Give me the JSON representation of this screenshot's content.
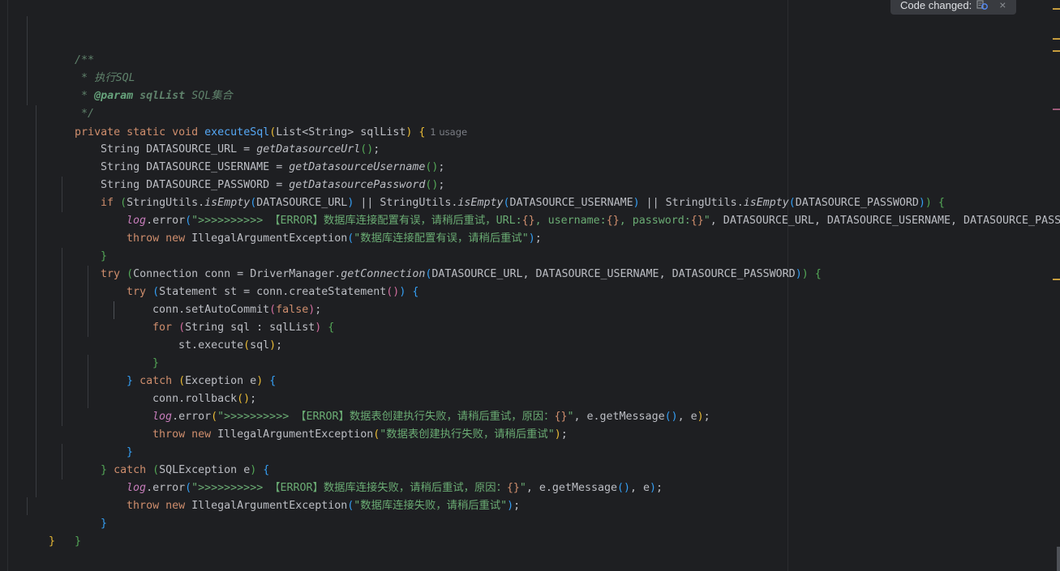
{
  "notification": {
    "text": "Code changed:",
    "close": "×"
  },
  "code": {
    "usage_hint": "1 usage",
    "lines": {
      "l1": "/**",
      "l2_prefix": " * ",
      "l2_text": "执行SQL",
      "l3_prefix": " * ",
      "l3_tag": "@param",
      "l3_param": "sqlList",
      "l3_desc": "SQL集合",
      "l4": " */",
      "l5_mod": "private static void ",
      "l5_fn": "executeSql",
      "l5_params": "List<String> sqlList",
      "l6_type": "String DATASOURCE_URL = ",
      "l6_call": "getDatasourceUrl",
      "l7_type": "String DATASOURCE_USERNAME = ",
      "l7_call": "getDatasourceUsername",
      "l8_type": "String DATASOURCE_PASSWORD = ",
      "l8_call": "getDatasourcePassword",
      "l9_kw": "if ",
      "l9_a": "StringUtils.",
      "l9_b": "isEmpty",
      "l9_c": "DATASOURCE_URL",
      "l9_d": " || StringUtils.",
      "l9_e": "DATASOURCE_USERNAME",
      "l9_f": "DATASOURCE_PASSWORD",
      "l10_log": "log",
      "l10_err": ".error",
      "l10_str1": "\">>>>>>>>>> 【ERROR】数据库连接配置有误，请稍后重试，URL:",
      "l10_ph": "{}",
      "l10_str2": ", username:",
      "l10_str3": ", password:",
      "l10_str4": "\"",
      "l10_rest": ", DATASOURCE_URL, DATASOURCE_USERNAME, DATASOURCE_PASSWORD",
      "l11_kw": "throw new ",
      "l11_cls": "IllegalArgumentException",
      "l11_str": "\"数据库连接配置有误，请稍后重试\"",
      "l13_kw": "try ",
      "l13_a": "Connection conn = DriverManager.",
      "l13_b": "getConnection",
      "l13_c": "DATASOURCE_URL, DATASOURCE_USERNAME, DATASOURCE_PASSWORD",
      "l14_kw": "try ",
      "l14_a": "Statement st = conn.createStatement",
      "l15_a": "conn.setAutoCommit",
      "l15_kw": "false",
      "l16_kw": "for ",
      "l16_a": "String sql : sqlList",
      "l17_a": "st.execute",
      "l17_b": "sql",
      "l19_kw": " catch ",
      "l19_a": "Exception e",
      "l20_a": "conn.rollback",
      "l21_str1": "\">>>>>>>>>> 【ERROR】数据表创建执行失败，请稍后重试，原因：",
      "l21_rest": ", e.getMessage",
      "l21_tail": ", e",
      "l22_str": "\"数据表创建执行失败，请稍后重试\"",
      "l24_a": "SQLException e",
      "l25_str1": "\">>>>>>>>>> 【ERROR】数据库连接失败，请稍后重试，原因：",
      "l26_str": "\"数据库连接失败，请稍后重试\""
    }
  },
  "colors": {
    "background": "#1e1f22",
    "keyword": "#cf8e6d",
    "string": "#6aab73",
    "function": "#56a8f5",
    "doc_comment": "#5f826b",
    "field": "#c77dbb"
  }
}
